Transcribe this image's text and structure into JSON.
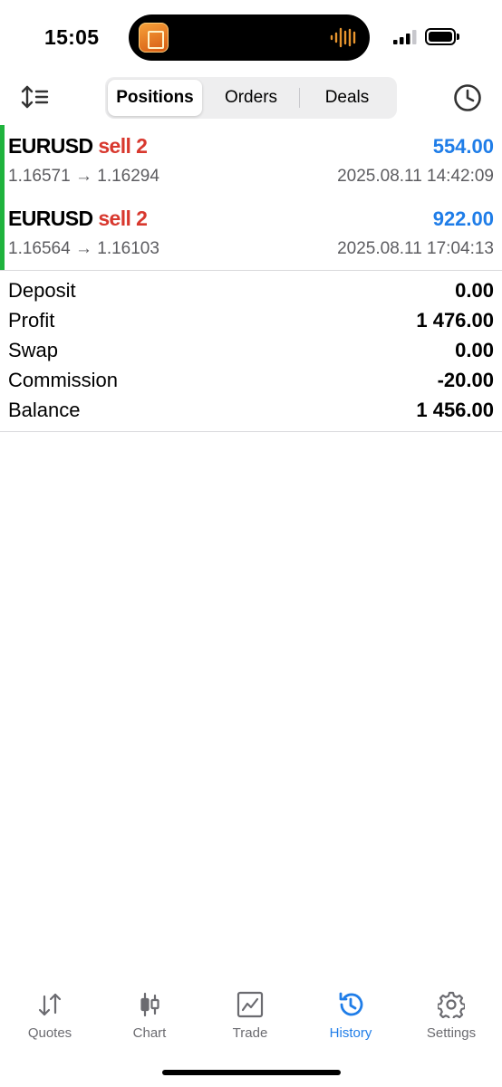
{
  "status_bar": {
    "time": "15:05",
    "island_app_icon": "trading-app-icon",
    "island_activity_icon": "audio-wave-icon"
  },
  "toolbar": {
    "sort_icon": "sort-icon",
    "history_icon": "clock-icon",
    "segments": [
      {
        "label": "Positions",
        "active": true
      },
      {
        "label": "Orders",
        "active": false
      },
      {
        "label": "Deals",
        "active": false
      }
    ]
  },
  "positions": [
    {
      "symbol": "EURUSD",
      "side": "sell 2",
      "profit": "554.00",
      "price_open": "1.16571",
      "price_close": "1.16294",
      "arrow": "→",
      "datetime": "2025.08.11 14:42:09"
    },
    {
      "symbol": "EURUSD",
      "side": "sell 2",
      "profit": "922.00",
      "price_open": "1.16564",
      "price_close": "1.16103",
      "arrow": "→",
      "datetime": "2025.08.11 17:04:13"
    }
  ],
  "summary": [
    {
      "label": "Deposit",
      "value": "0.00"
    },
    {
      "label": "Profit",
      "value": "1 476.00"
    },
    {
      "label": "Swap",
      "value": "0.00"
    },
    {
      "label": "Commission",
      "value": "-20.00"
    },
    {
      "label": "Balance",
      "value": "1 456.00"
    }
  ],
  "tabbar": [
    {
      "label": "Quotes",
      "icon": "quotes-icon",
      "active": false
    },
    {
      "label": "Chart",
      "icon": "candlestick-icon",
      "active": false
    },
    {
      "label": "Trade",
      "icon": "trade-chart-icon",
      "active": false
    },
    {
      "label": "History",
      "icon": "history-icon",
      "active": true
    },
    {
      "label": "Settings",
      "icon": "gear-icon",
      "active": false
    }
  ],
  "colors": {
    "accent_blue": "#1f7de8",
    "sell_red": "#d8382e",
    "position_bar_green": "#1fb33d",
    "secondary_text": "#5c5c60"
  }
}
